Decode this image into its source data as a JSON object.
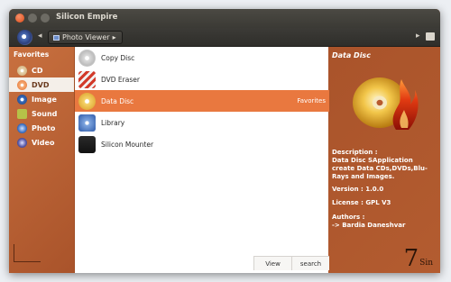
{
  "window": {
    "title": "Silicon Empire"
  },
  "toolbar": {
    "breadcrumb": "Photo Viewer"
  },
  "sidebar": {
    "heading": "Favorites",
    "items": [
      {
        "label": "CD",
        "icon": "cd-icon",
        "color": "#e8d5b0"
      },
      {
        "label": "DVD",
        "icon": "dvd-icon",
        "color": "#f08a4b",
        "selected": true
      },
      {
        "label": "Image",
        "icon": "image-icon",
        "color": "#2f5fa8"
      },
      {
        "label": "Sound",
        "icon": "sound-icon",
        "color": "#8a9b3a"
      },
      {
        "label": "Photo",
        "icon": "photo-icon",
        "color": "#3b6fc2"
      },
      {
        "label": "Video",
        "icon": "video-icon",
        "color": "#4a4a8c"
      }
    ]
  },
  "list": {
    "items": [
      {
        "label": "Copy Disc",
        "icon": "copy-disc-icon"
      },
      {
        "label": "DVD Eraser",
        "icon": "dvd-eraser-icon"
      },
      {
        "label": "Data Disc",
        "icon": "data-disc-icon",
        "selected": true,
        "tag": "Favorites"
      },
      {
        "label": "Library",
        "icon": "library-icon"
      },
      {
        "label": "Silicon Mounter",
        "icon": "silicon-mounter-icon"
      }
    ],
    "footer": {
      "view": "View",
      "search": "search"
    }
  },
  "details": {
    "title": "Data Disc",
    "description_heading": "Description :",
    "description": "Data Disc SApplication create Data CDs,DVDs,Blu-Rays and Images.",
    "version": "Version : 1.0.0",
    "license": "License : GPL V3",
    "authors_heading": "Authors :",
    "authors": "-> Bardia Daneshvar",
    "badge_big": "7",
    "badge_small": "Sin"
  },
  "colors": {
    "accent": "#e9783f",
    "panel": "#b85a2e"
  }
}
